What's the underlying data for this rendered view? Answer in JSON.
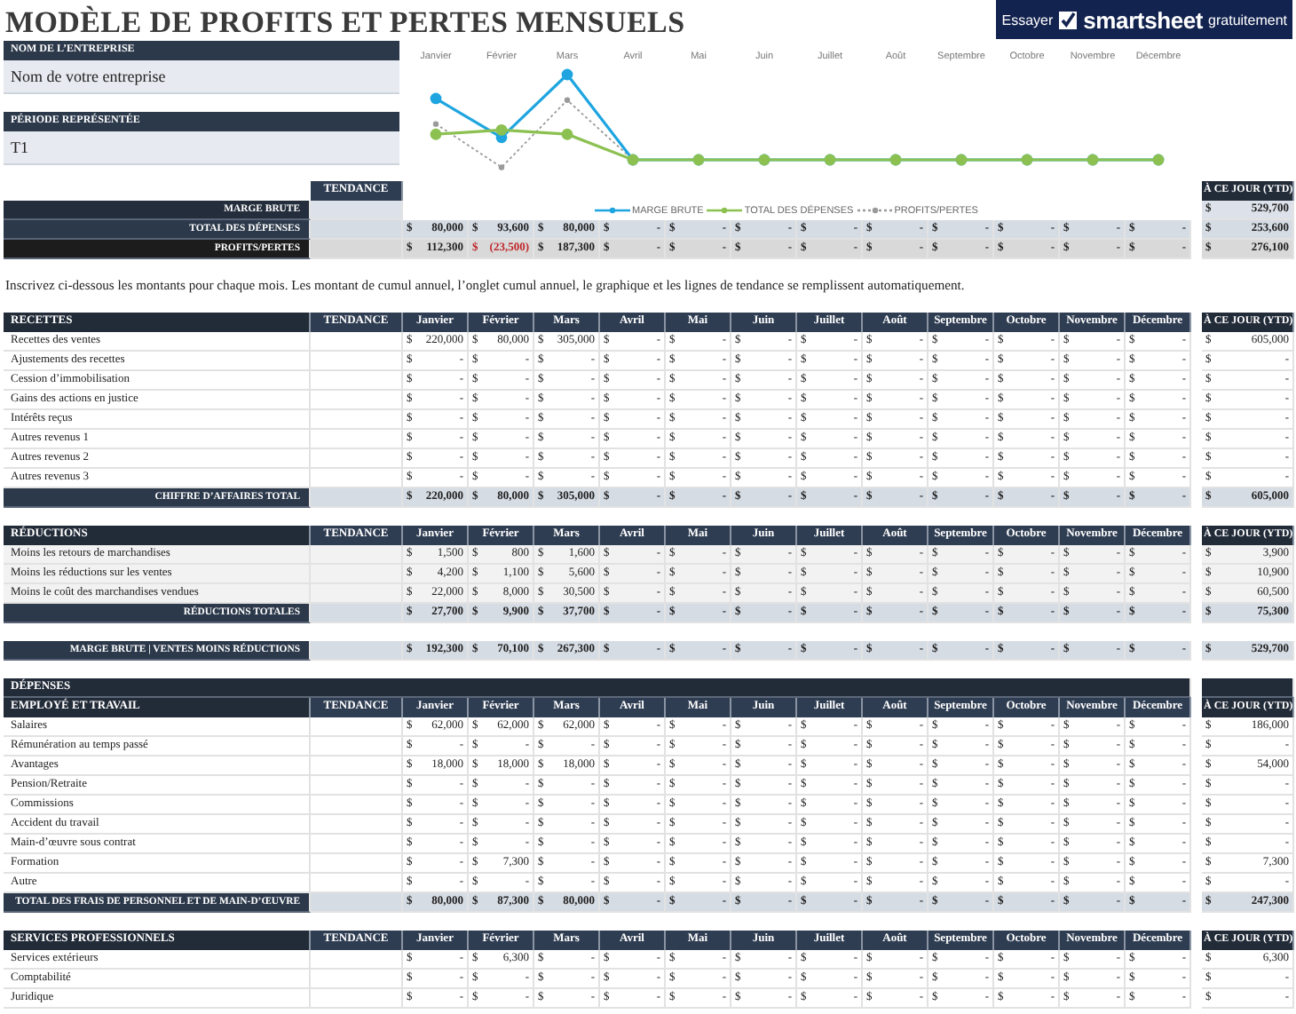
{
  "title": "MODÈLE DE PROFITS ET PERTES MENSUELS",
  "promo": {
    "before": "Essayer",
    "brand": "smartsheet",
    "after": "gratuitement"
  },
  "company": {
    "label": "NOM DE L’ENTREPRISE",
    "value": "Nom de votre entreprise"
  },
  "period": {
    "label": "PÉRIODE REPRÉSENTÉE",
    "value": "T1"
  },
  "chart": {
    "months": [
      "Janvier",
      "Février",
      "Mars",
      "Avril",
      "Mai",
      "Juin",
      "Juillet",
      "Août",
      "Septembre",
      "Octobre",
      "Novembre",
      "Décembre"
    ],
    "legend": [
      {
        "kind": "margin",
        "label": "MARGE BRUTE"
      },
      {
        "kind": "expenses",
        "label": "TOTAL DES DÉPENSES"
      },
      {
        "kind": "profit",
        "label": "PROFITS/PERTES"
      }
    ]
  },
  "summary": {
    "tendance": "TENDANCE",
    "ytd_header": "À CE JOUR (YTD)",
    "rows": [
      {
        "kind": "margin",
        "label": "MARGE BRUTE",
        "ytd": "$ 529,700"
      },
      {
        "kind": "expenses",
        "label": "TOTAL DES DÉPENSES",
        "values": [
          "$ 80,000",
          "$ 93,600",
          "$ 80,000",
          "$ -",
          "$ -",
          "$ -",
          "$ -",
          "$ -",
          "$ -",
          "$ -",
          "$ -",
          "$ -"
        ],
        "ytd": "$ 253,600"
      },
      {
        "kind": "profit",
        "label": "PROFITS/PERTES",
        "values": [
          "$ 112,300",
          "$ (23,500)",
          "$ 187,300",
          "$ -",
          "$ -",
          "$ -",
          "$ -",
          "$ -",
          "$ -",
          "$ -",
          "$ -",
          "$ -"
        ],
        "ytd": "$ 276,100"
      }
    ]
  },
  "instructions": "Inscrivez ci-dessous les montants pour chaque mois. Les montant de cumul annuel, l’onglet cumul annuel, le graphique et les lignes de tendance se remplissent automatiquement.",
  "sections": [
    {
      "kind": "income",
      "heading": "RECETTES",
      "tendance": "TENDANCE",
      "months": [
        "Janvier",
        "Février",
        "Mars",
        "Avril",
        "Mai",
        "Juin",
        "Juillet",
        "Août",
        "Septembre",
        "Octobre",
        "Novembre",
        "Décembre"
      ],
      "ytd_header": "À CE JOUR (YTD)",
      "rows": [
        {
          "label": "Recettes des ventes",
          "values": [
            "$ 220,000",
            "$ 80,000",
            "$ 305,000",
            "$ -",
            "$ -",
            "$ -",
            "$ -",
            "$ -",
            "$ -",
            "$ -",
            "$ -",
            "$ -"
          ],
          "ytd": "$ 605,000"
        },
        {
          "label": "Ajustements des recettes",
          "values": [
            "$ -",
            "$ -",
            "$ -",
            "$ -",
            "$ -",
            "$ -",
            "$ -",
            "$ -",
            "$ -",
            "$ -",
            "$ -",
            "$ -"
          ],
          "ytd": "$ -"
        },
        {
          "label": "Cession d’immobilisation",
          "values": [
            "$ -",
            "$ -",
            "$ -",
            "$ -",
            "$ -",
            "$ -",
            "$ -",
            "$ -",
            "$ -",
            "$ -",
            "$ -",
            "$ -"
          ],
          "ytd": "$ -"
        },
        {
          "label": "Gains des actions en justice",
          "values": [
            "$ -",
            "$ -",
            "$ -",
            "$ -",
            "$ -",
            "$ -",
            "$ -",
            "$ -",
            "$ -",
            "$ -",
            "$ -",
            "$ -"
          ],
          "ytd": "$ -"
        },
        {
          "label": "Intérêts reçus",
          "values": [
            "$ -",
            "$ -",
            "$ -",
            "$ -",
            "$ -",
            "$ -",
            "$ -",
            "$ -",
            "$ -",
            "$ -",
            "$ -",
            "$ -"
          ],
          "ytd": "$ -"
        },
        {
          "label": "Autres revenus 1",
          "values": [
            "$ -",
            "$ -",
            "$ -",
            "$ -",
            "$ -",
            "$ -",
            "$ -",
            "$ -",
            "$ -",
            "$ -",
            "$ -",
            "$ -"
          ],
          "ytd": "$ -"
        },
        {
          "label": "Autres revenus 2",
          "values": [
            "$ -",
            "$ -",
            "$ -",
            "$ -",
            "$ -",
            "$ -",
            "$ -",
            "$ -",
            "$ -",
            "$ -",
            "$ -",
            "$ -"
          ],
          "ytd": "$ -"
        },
        {
          "label": "Autres revenus 3",
          "values": [
            "$ -",
            "$ -",
            "$ -",
            "$ -",
            "$ -",
            "$ -",
            "$ -",
            "$ -",
            "$ -",
            "$ -",
            "$ -",
            "$ -"
          ],
          "ytd": "$ -"
        }
      ],
      "total": {
        "label": "CHIFFRE D’AFFAIRES TOTAL",
        "values": [
          "$ 220,000",
          "$ 80,000",
          "$ 305,000",
          "$ -",
          "$ -",
          "$ -",
          "$ -",
          "$ -",
          "$ -",
          "$ -",
          "$ -",
          "$ -"
        ],
        "ytd": "$ 605,000"
      }
    },
    {
      "kind": "deductions",
      "heading": "RÉDUCTIONS",
      "tendance": "TENDANCE",
      "months": [
        "Janvier",
        "Février",
        "Mars",
        "Avril",
        "Mai",
        "Juin",
        "Juillet",
        "Août",
        "Septembre",
        "Octobre",
        "Novembre",
        "Décembre"
      ],
      "ytd_header": "À CE JOUR (YTD)",
      "rows": [
        {
          "label": "Moins les retours de marchandises",
          "values": [
            "$ 1,500",
            "$ 800",
            "$ 1,600",
            "$ -",
            "$ -",
            "$ -",
            "$ -",
            "$ -",
            "$ -",
            "$ -",
            "$ -",
            "$ -"
          ],
          "ytd": "$ 3,900"
        },
        {
          "label": "Moins les réductions sur les ventes",
          "values": [
            "$ 4,200",
            "$ 1,100",
            "$ 5,600",
            "$ -",
            "$ -",
            "$ -",
            "$ -",
            "$ -",
            "$ -",
            "$ -",
            "$ -",
            "$ -"
          ],
          "ytd": "$ 10,900"
        },
        {
          "label": "Moins le coût des marchandises vendues",
          "values": [
            "$ 22,000",
            "$ 8,000",
            "$ 30,500",
            "$ -",
            "$ -",
            "$ -",
            "$ -",
            "$ -",
            "$ -",
            "$ -",
            "$ -",
            "$ -"
          ],
          "ytd": "$ 60,500"
        }
      ],
      "total": {
        "label": "RÉDUCTIONS TOTALES",
        "values": [
          "$ 27,700",
          "$ 9,900",
          "$ 37,700",
          "$ -",
          "$ -",
          "$ -",
          "$ -",
          "$ -",
          "$ -",
          "$ -",
          "$ -",
          "$ -"
        ],
        "ytd": "$ 75,300"
      }
    },
    {
      "kind": "margin",
      "total": {
        "label": "MARGE BRUTE | VENTES MOINS RÉDUCTIONS",
        "values": [
          "$ 192,300",
          "$ 70,100",
          "$ 267,300",
          "$ -",
          "$ -",
          "$ -",
          "$ -",
          "$ -",
          "$ -",
          "$ -",
          "$ -",
          "$ -"
        ],
        "ytd": "$ 529,700"
      }
    },
    {
      "kind": "expenses",
      "group_heading": "DÉPENSES",
      "heading": "EMPLOYÉ ET TRAVAIL",
      "tendance": "TENDANCE",
      "months": [
        "Janvier",
        "Février",
        "Mars",
        "Avril",
        "Mai",
        "Juin",
        "Juillet",
        "Août",
        "Septembre",
        "Octobre",
        "Novembre",
        "Décembre"
      ],
      "ytd_header": "À CE JOUR (YTD)",
      "rows": [
        {
          "label": "Salaires",
          "values": [
            "$ 62,000",
            "$ 62,000",
            "$ 62,000",
            "$ -",
            "$ -",
            "$ -",
            "$ -",
            "$ -",
            "$ -",
            "$ -",
            "$ -",
            "$ -"
          ],
          "ytd": "$ 186,000"
        },
        {
          "label": "Rémunération au temps passé",
          "values": [
            "$ -",
            "$ -",
            "$ -",
            "$ -",
            "$ -",
            "$ -",
            "$ -",
            "$ -",
            "$ -",
            "$ -",
            "$ -",
            "$ -"
          ],
          "ytd": "$ -"
        },
        {
          "label": "Avantages",
          "values": [
            "$ 18,000",
            "$ 18,000",
            "$ 18,000",
            "$ -",
            "$ -",
            "$ -",
            "$ -",
            "$ -",
            "$ -",
            "$ -",
            "$ -",
            "$ -"
          ],
          "ytd": "$ 54,000"
        },
        {
          "label": "Pension/Retraite",
          "values": [
            "$ -",
            "$ -",
            "$ -",
            "$ -",
            "$ -",
            "$ -",
            "$ -",
            "$ -",
            "$ -",
            "$ -",
            "$ -",
            "$ -"
          ],
          "ytd": "$ -"
        },
        {
          "label": "Commissions",
          "values": [
            "$ -",
            "$ -",
            "$ -",
            "$ -",
            "$ -",
            "$ -",
            "$ -",
            "$ -",
            "$ -",
            "$ -",
            "$ -",
            "$ -"
          ],
          "ytd": "$ -"
        },
        {
          "label": "Accident du travail",
          "values": [
            "$ -",
            "$ -",
            "$ -",
            "$ -",
            "$ -",
            "$ -",
            "$ -",
            "$ -",
            "$ -",
            "$ -",
            "$ -",
            "$ -"
          ],
          "ytd": "$ -"
        },
        {
          "label": "Main-d’œuvre sous contrat",
          "values": [
            "$ -",
            "$ -",
            "$ -",
            "$ -",
            "$ -",
            "$ -",
            "$ -",
            "$ -",
            "$ -",
            "$ -",
            "$ -",
            "$ -"
          ],
          "ytd": "$ -"
        },
        {
          "label": "Formation",
          "values": [
            "$ -",
            "$ 7,300",
            "$ -",
            "$ -",
            "$ -",
            "$ -",
            "$ -",
            "$ -",
            "$ -",
            "$ -",
            "$ -",
            "$ -"
          ],
          "ytd": "$ 7,300"
        },
        {
          "label": "Autre",
          "values": [
            "$ -",
            "$ -",
            "$ -",
            "$ -",
            "$ -",
            "$ -",
            "$ -",
            "$ -",
            "$ -",
            "$ -",
            "$ -",
            "$ -"
          ],
          "ytd": "$ -"
        }
      ],
      "total": {
        "label": "TOTAL DES FRAIS DE PERSONNEL ET DE MAIN-D’ŒUVRE",
        "values": [
          "$ 80,000",
          "$ 87,300",
          "$ 80,000",
          "$ -",
          "$ -",
          "$ -",
          "$ -",
          "$ -",
          "$ -",
          "$ -",
          "$ -",
          "$ -"
        ],
        "ytd": "$ 247,300"
      }
    },
    {
      "kind": "services",
      "heading": "SERVICES PROFESSIONNELS",
      "tendance": "TENDANCE",
      "months": [
        "Janvier",
        "Février",
        "Mars",
        "Avril",
        "Mai",
        "Juin",
        "Juillet",
        "Août",
        "Septembre",
        "Octobre",
        "Novembre",
        "Décembre"
      ],
      "ytd_header": "À CE JOUR (YTD)",
      "rows": [
        {
          "label": "Services extérieurs",
          "values": [
            "$ -",
            "$ 6,300",
            "$ -",
            "$ -",
            "$ -",
            "$ -",
            "$ -",
            "$ -",
            "$ -",
            "$ -",
            "$ -",
            "$ -"
          ],
          "ytd": "$ 6,300"
        },
        {
          "label": "Comptabilité",
          "values": [
            "$ -",
            "$ -",
            "$ -",
            "$ -",
            "$ -",
            "$ -",
            "$ -",
            "$ -",
            "$ -",
            "$ -",
            "$ -",
            "$ -"
          ],
          "ytd": "$ -"
        },
        {
          "label": "Juridique",
          "values": [
            "$ -",
            "$ -",
            "$ -",
            "$ -",
            "$ -",
            "$ -",
            "$ -",
            "$ -",
            "$ -",
            "$ -",
            "$ -",
            "$ -"
          ],
          "ytd": "$ -"
        }
      ]
    }
  ]
}
